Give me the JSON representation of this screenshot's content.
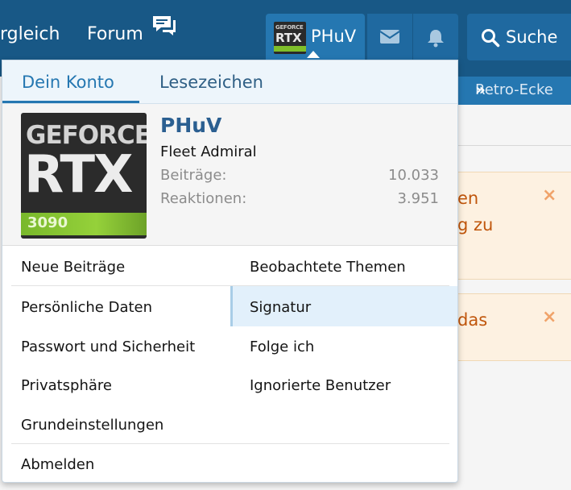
{
  "header": {
    "nav_left": "rgleich",
    "nav_forum": "Forum",
    "forum_icon": "chat-bubbles-icon",
    "username": "PHuV",
    "avatar_top_text": "GEFORCE",
    "avatar_main_text": "RTX",
    "message_icon": "envelope-icon",
    "notification_icon": "bell-icon",
    "search_label": "Suche",
    "search_icon": "search-icon"
  },
  "background": {
    "subnav_text": "Retro-Ecke",
    "notice1_text": "en\ng zu",
    "notice2_text": "das",
    "close_glyph": "×"
  },
  "popup": {
    "tabs": [
      {
        "label": "Dein Konto",
        "active": true
      },
      {
        "label": "Lesezeichen",
        "active": false
      }
    ],
    "profile": {
      "name": "PHuV",
      "title": "Fleet Admiral",
      "stats": [
        {
          "label": "Beiträge:",
          "value": "10.033"
        },
        {
          "label": "Reaktionen:",
          "value": "3.951"
        }
      ],
      "avatar": {
        "line1": "GEFORCE",
        "line2": "RTX",
        "model": "3090"
      }
    },
    "menu_left": [
      "Neue Beiträge",
      "Persönliche Daten",
      "Passwort und Sicherheit",
      "Privatsphäre",
      "Grundeinstellungen"
    ],
    "menu_right": [
      "Beobachtete Themen",
      "Signatur",
      "Folge ich",
      "Ignorierte Benutzer"
    ],
    "logout": "Abmelden",
    "highlighted_item": "Signatur"
  },
  "colors": {
    "header_bg": "#185886",
    "accent": "#2577b1",
    "username_color": "#2b5f91",
    "notice_text": "#c0560c"
  }
}
